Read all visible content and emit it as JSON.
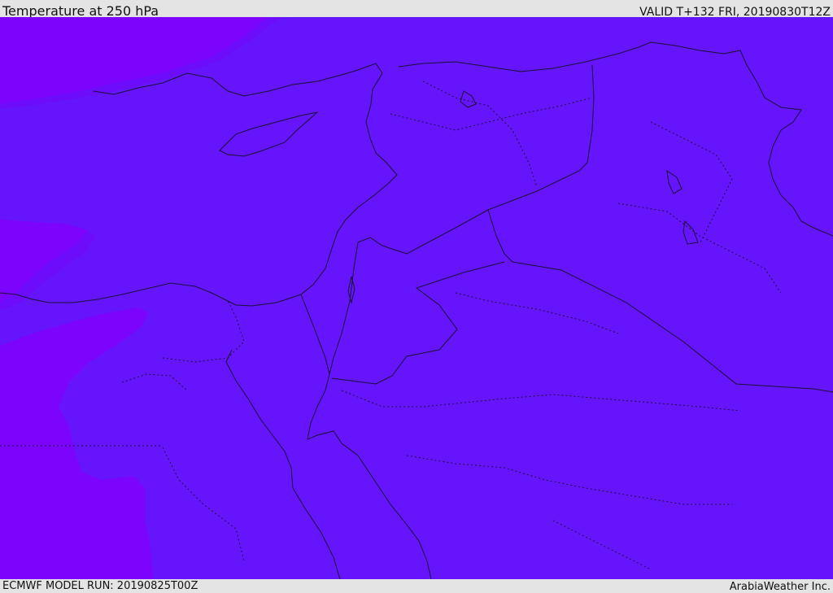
{
  "header": {
    "title": "Temperature at 250 hPa",
    "valid_time": "VALID T+132 FRI, 20190830T12Z"
  },
  "footer": {
    "model_run": "ECMWF MODEL RUN: 20190825T00Z",
    "credit": "ArabiaWeather Inc."
  },
  "map": {
    "field": "temperature",
    "level": "250 hPa",
    "colors": {
      "dominant": "#6514fb",
      "cold_zone": "#7d04fc",
      "transition_zone": "#6d0cfb",
      "borders": "#1a1035"
    }
  }
}
